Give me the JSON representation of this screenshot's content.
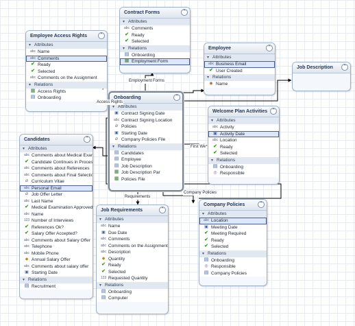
{
  "canvas": {
    "background": "#ffffff",
    "grid_color": "#e8ecf1",
    "entity_fill": "#f4f7fb",
    "highlight_fill": "#dde7fb",
    "link_color": "#000000"
  },
  "entities": [
    {
      "id": "contract-forms",
      "title": "Contract Forms",
      "attributes": [
        {
          "icon": "text",
          "label": "Comments"
        },
        {
          "icon": "check",
          "label": "Ready"
        },
        {
          "icon": "check",
          "label": "Selected"
        }
      ],
      "relations": [
        {
          "icon": "relation",
          "label": "Onboarding"
        },
        {
          "icon": "table",
          "label": "Employment Form",
          "highlight": true
        }
      ]
    },
    {
      "id": "employee-access-rights",
      "title": "Employee Access Rights",
      "attributes": [
        {
          "icon": "text",
          "label": "Name"
        },
        {
          "icon": "text",
          "label": "Comments",
          "highlight": true
        },
        {
          "icon": "check",
          "label": "Ready"
        },
        {
          "icon": "check",
          "label": "Selected"
        },
        {
          "icon": "text",
          "label": "Comments on the Assignment"
        }
      ],
      "relations": [
        {
          "icon": "table",
          "label": "Access Rights"
        },
        {
          "icon": "relation",
          "label": "Onboarding"
        }
      ]
    },
    {
      "id": "employee",
      "title": "Employee",
      "attributes": [
        {
          "icon": "text",
          "label": "Business Email",
          "highlight": true
        },
        {
          "icon": "check",
          "label": "User Created"
        }
      ],
      "relations": [
        {
          "icon": "user",
          "label": "Name"
        }
      ]
    },
    {
      "id": "job-description",
      "title": "Job Description",
      "attributes": [],
      "relations": []
    },
    {
      "id": "onboarding",
      "title": "Onboarding",
      "attributes": [
        {
          "icon": "date",
          "label": "Contract Signing Date"
        },
        {
          "icon": "text",
          "label": "Contract Signing Location"
        },
        {
          "icon": "clip",
          "label": "Policies"
        },
        {
          "icon": "date",
          "label": "Starting Date"
        },
        {
          "icon": "clip",
          "label": "Company Policies File"
        }
      ],
      "relations": [
        {
          "icon": "relation",
          "label": "Candidates"
        },
        {
          "icon": "relation",
          "label": "Employee"
        },
        {
          "icon": "relation",
          "label": "Job Description"
        },
        {
          "icon": "table",
          "label": "Job Description Par"
        },
        {
          "icon": "table",
          "label": "Policies File"
        }
      ]
    },
    {
      "id": "welcome-plan-activities",
      "title": "Welcome Plan Activities",
      "attributes": [
        {
          "icon": "text",
          "label": "Activity"
        },
        {
          "icon": "date",
          "label": "Activity Date",
          "highlight": true
        },
        {
          "icon": "text",
          "label": "Location"
        },
        {
          "icon": "check",
          "label": "Ready"
        },
        {
          "icon": "check",
          "label": "Selected"
        }
      ],
      "relations": [
        {
          "icon": "relation",
          "label": "Onboarding"
        },
        {
          "icon": "people",
          "label": "Responsible"
        }
      ]
    },
    {
      "id": "candidates",
      "title": "Candidates",
      "attributes": [
        {
          "icon": "text",
          "label": "Comments about Medical Exam"
        },
        {
          "icon": "check",
          "label": "Candidate Continues in Process"
        },
        {
          "icon": "text",
          "label": "Comments about References"
        },
        {
          "icon": "text",
          "label": "Comments about Final Selection"
        },
        {
          "icon": "clip",
          "label": "Curriculum Vitae"
        },
        {
          "icon": "text",
          "label": "Personal Email",
          "highlight": true
        },
        {
          "icon": "clip",
          "label": "Job Offer Letter"
        },
        {
          "icon": "text",
          "label": "Last Name"
        },
        {
          "icon": "check",
          "label": "Medical Examination Approved"
        },
        {
          "icon": "text",
          "label": "Name"
        },
        {
          "icon": "number",
          "label": "Number of Interviews"
        },
        {
          "icon": "check",
          "label": "References Ok?"
        },
        {
          "icon": "check",
          "label": "Salary Offer Accepted?"
        },
        {
          "icon": "text",
          "label": "Comments about Salary Offer"
        },
        {
          "icon": "text",
          "label": "Telephone"
        },
        {
          "icon": "text",
          "label": "Mobile Phone"
        },
        {
          "icon": "currency",
          "label": "Annual Salary Offer"
        },
        {
          "icon": "text",
          "label": "Comments about salary offer"
        },
        {
          "icon": "date",
          "label": "Starting Date"
        }
      ],
      "relations": [
        {
          "icon": "relation",
          "label": "Recruitment"
        }
      ]
    },
    {
      "id": "job-requirements",
      "title": "Job Requirements",
      "attributes": [
        {
          "icon": "text",
          "label": "Name"
        },
        {
          "icon": "date",
          "label": "Due Date"
        },
        {
          "icon": "text",
          "label": "Comments"
        },
        {
          "icon": "text",
          "label": "Comments on the Assignment"
        },
        {
          "icon": "text",
          "label": "Description"
        },
        {
          "icon": "currency",
          "label": "Quantity"
        },
        {
          "icon": "check",
          "label": "Ready"
        },
        {
          "icon": "check",
          "label": "Selected"
        },
        {
          "icon": "number",
          "label": "Requested Quantity"
        }
      ],
      "relations": [
        {
          "icon": "relation",
          "label": "Onboarding"
        },
        {
          "icon": "relation",
          "label": "Computer"
        }
      ]
    },
    {
      "id": "company-policies",
      "title": "Company Policies",
      "attributes": [
        {
          "icon": "text",
          "label": "Location",
          "highlight": true
        },
        {
          "icon": "date",
          "label": "Meeting Date"
        },
        {
          "icon": "check",
          "label": "Meeting Required"
        },
        {
          "icon": "check",
          "label": "Ready"
        },
        {
          "icon": "check",
          "label": "Selected"
        }
      ],
      "relations": [
        {
          "icon": "relation",
          "label": "Onboarding"
        },
        {
          "icon": "people",
          "label": "Responsible"
        },
        {
          "icon": "relation",
          "label": "Company Policies"
        }
      ]
    }
  ],
  "section_labels": {
    "attributes": "Attributes",
    "relations": "Relations"
  },
  "collapse_glyph": "⌃",
  "connector_labels": {
    "employment_forms": "Employment Forms",
    "access_rights": "Access Rights",
    "first_welcome": "First We",
    "requirements": "Requirements",
    "company_policies": "Company Policies",
    "cardinality_star": "*"
  },
  "icon_glyphs": {
    "text": "abc",
    "check": "✔",
    "relation": "▤",
    "table": "▦",
    "clip": "⌀",
    "date": "▣",
    "user": "◉",
    "people": "◎",
    "currency": "◆",
    "number": "123"
  }
}
